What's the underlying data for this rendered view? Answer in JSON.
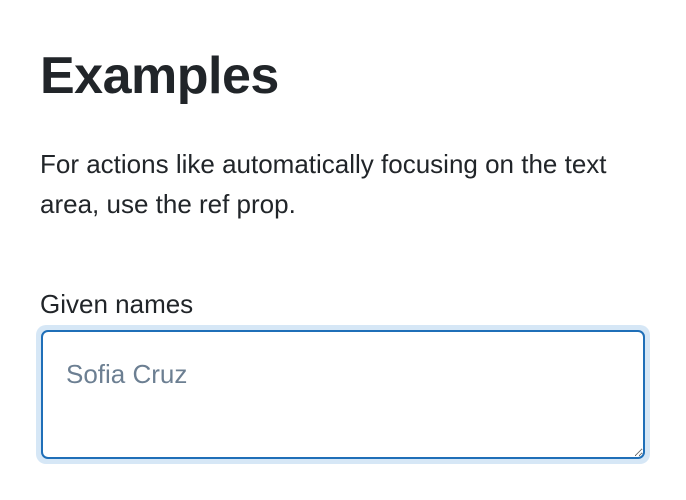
{
  "heading": "Examples",
  "description": "For actions like automatically focusing on the text area, use the ref prop.",
  "field": {
    "label": "Given names",
    "placeholder": "Sofia Cruz",
    "value": ""
  },
  "colors": {
    "text": "#212529",
    "focus_border": "#1f6fb8",
    "focus_ring": "#d6e7f6",
    "placeholder": "#6c7f92"
  }
}
